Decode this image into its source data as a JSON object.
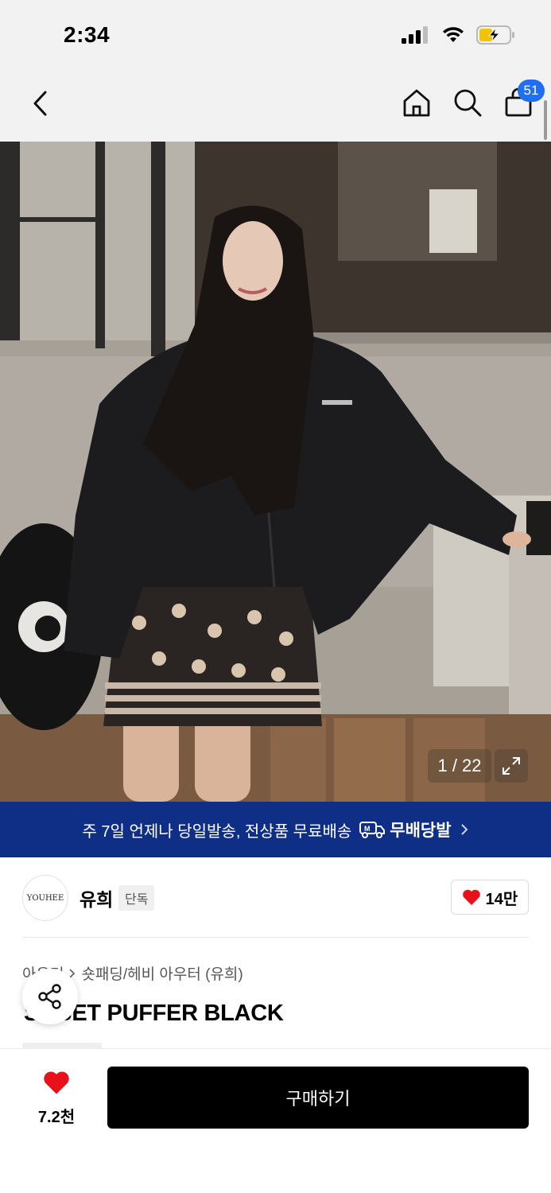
{
  "status_bar": {
    "time": "2:34"
  },
  "nav": {
    "cart_count": "51"
  },
  "gallery": {
    "counter": "1 / 22"
  },
  "promo": {
    "text": "주 7일 언제나 당일발송, 전상품 무료배송",
    "brand": "무배당발"
  },
  "brand": {
    "logo_text": "YOUHEE",
    "name": "유희",
    "tag": "단독",
    "likes": "14만"
  },
  "product": {
    "breadcrumb": [
      "아우터",
      "숏패딩/헤비 아우터 (유희)"
    ],
    "title": "SABET PUFFER BLACK"
  },
  "bottom": {
    "wish_count": "7.2천",
    "buy_label": "구매하기"
  },
  "colors": {
    "promo_bg": "#0f2f86",
    "badge": "#1e6ff5",
    "heart": "#e8101a",
    "buy_bg": "#000000"
  }
}
